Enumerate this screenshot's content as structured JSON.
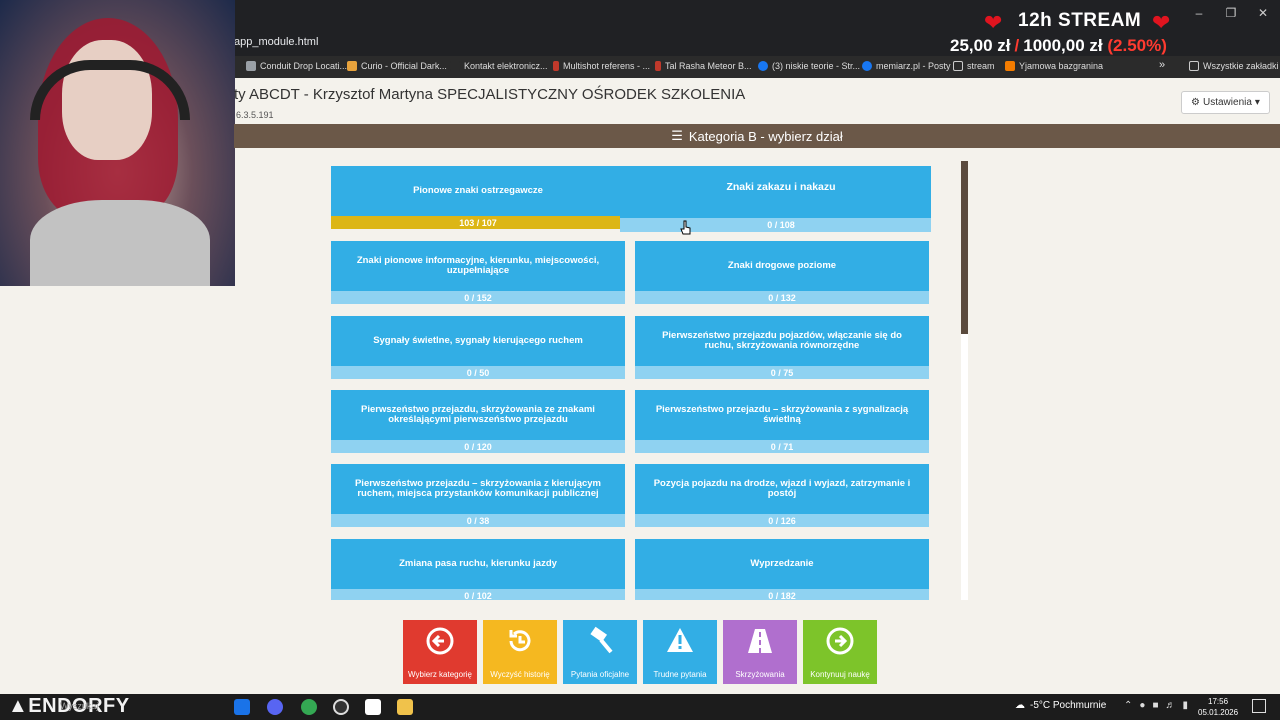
{
  "browser": {
    "url": "app_module.html",
    "bookmarks": [
      {
        "label": "Conduit Drop Locati...",
        "icon": "bookmark-icon",
        "color": "#9aa0a6"
      },
      {
        "label": "Curio - Official Dark...",
        "icon": "curio-icon",
        "color": "#e8a33c"
      },
      {
        "label": "Kontakt elektronicz...",
        "icon": "page-icon",
        "color": "#2b2b2b"
      },
      {
        "label": "Multishot referens - ...",
        "icon": "multishot-icon",
        "color": "#c0392b"
      },
      {
        "label": "Tal Rasha Meteor B...",
        "icon": "tal-rasha-icon",
        "color": "#c0392b"
      },
      {
        "label": "(3) niskie teorie - Str...",
        "icon": "facebook-icon",
        "color": "#1877f2"
      },
      {
        "label": "memiarz.pl - Posty",
        "icon": "facebook-icon",
        "color": "#1877f2"
      },
      {
        "label": "stream",
        "icon": "folder-icon",
        "color": "#9aa0a6"
      },
      {
        "label": "Yjamowa bazgranina",
        "icon": "blogger-icon",
        "color": "#f57d00"
      }
    ],
    "all_bookmarks": "Wszystkie zakładki",
    "more": "»"
  },
  "overlay": {
    "title": "12h STREAM",
    "current": "25,00 zł",
    "goal": "1000,00 zł",
    "percent": "(2.50%)",
    "accent": "#e0141f"
  },
  "page": {
    "title": "ty ABCDT - Krzysztof Martyna SPECJALISTYCZNY OŚRODEK SZKOLENIA",
    "version": "6.3.5.191",
    "settings": "Ustawienia",
    "category_bar": "Kategoria B - wybierz dział"
  },
  "tiles": [
    {
      "label": "Pionowe znaki ostrzegawcze",
      "progress": "103 / 107",
      "done": 103,
      "total": 107
    },
    {
      "label": "Znaki zakazu i nakazu",
      "progress": "0 / 108",
      "done": 0,
      "total": 108
    },
    {
      "label": "Znaki pionowe informacyjne, kierunku, miejscowości, uzupełniające",
      "progress": "0 / 152",
      "done": 0,
      "total": 152
    },
    {
      "label": "Znaki drogowe poziome",
      "progress": "0 / 132",
      "done": 0,
      "total": 132
    },
    {
      "label": "Sygnały świetlne, sygnały kierującego ruchem",
      "progress": "0 / 50",
      "done": 0,
      "total": 50
    },
    {
      "label": "Pierwszeństwo przejazdu pojazdów, włączanie się do ruchu, skrzyżowania równorzędne",
      "progress": "0 / 75",
      "done": 0,
      "total": 75
    },
    {
      "label": "Pierwszeństwo przejazdu, skrzyżowania ze znakami określającymi pierwszeństwo przejazdu",
      "progress": "0 / 120",
      "done": 0,
      "total": 120
    },
    {
      "label": "Pierwszeństwo przejazdu – skrzyżowania z sygnalizacją świetlną",
      "progress": "0 / 71",
      "done": 0,
      "total": 71
    },
    {
      "label": "Pierwszeństwo przejazdu – skrzyżowania z kierującym ruchem, miejsca przystanków komunikacji publicznej",
      "progress": "0 / 38",
      "done": 0,
      "total": 38
    },
    {
      "label": "Pozycja pojazdu na drodze, wjazd i wyjazd, zatrzymanie i postój",
      "progress": "0 / 126",
      "done": 0,
      "total": 126
    },
    {
      "label": "Zmiana pasa ruchu, kierunku jazdy",
      "progress": "0 / 102",
      "done": 0,
      "total": 102
    },
    {
      "label": "Wyprzedzanie",
      "progress": "0 / 182",
      "done": 0,
      "total": 182
    }
  ],
  "toolbar": [
    {
      "label": "Wybierz kategorię",
      "icon": "arrow-left-circle-icon",
      "color": "#e03a2f"
    },
    {
      "label": "Wyczyść historię",
      "icon": "history-reset-icon",
      "color": "#f5b820"
    },
    {
      "label": "Pytania oficjalne",
      "icon": "gavel-icon",
      "color": "#32aee5"
    },
    {
      "label": "Trudne pytania",
      "icon": "warning-icon",
      "color": "#32aee5"
    },
    {
      "label": "Skrzyżowania",
      "icon": "road-icon",
      "color": "#b06fce"
    },
    {
      "label": "Kontynuuj naukę",
      "icon": "arrow-right-circle-icon",
      "color": "#7dc42a"
    }
  ],
  "taskbar": {
    "brand": "ENDORFY",
    "search": "Wyszukaj",
    "weather": "-5°C  Pochmurnie",
    "time": "17:56",
    "date": "05.01.2026"
  }
}
